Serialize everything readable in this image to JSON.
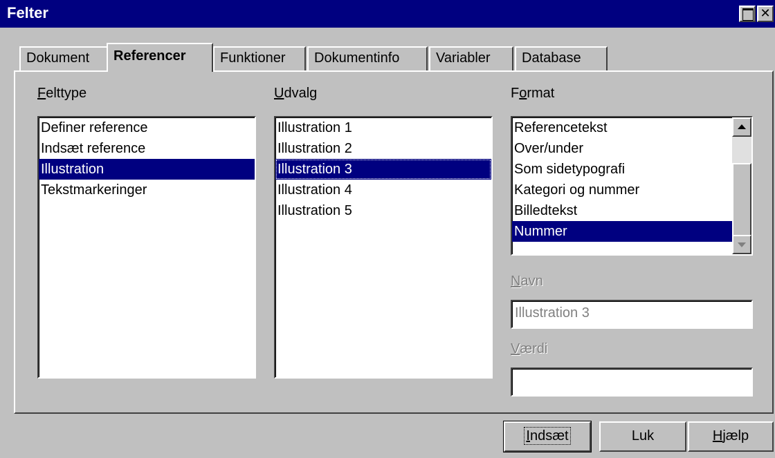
{
  "window": {
    "title": "Felter"
  },
  "tabs": [
    {
      "label": "Dokument",
      "active": false
    },
    {
      "label": "Referencer",
      "active": true
    },
    {
      "label": "Funktioner",
      "active": false
    },
    {
      "label": "Dokumentinfo",
      "active": false
    },
    {
      "label": "Variabler",
      "active": false
    },
    {
      "label": "Database",
      "active": false
    }
  ],
  "felttype": {
    "label_hotkey": "F",
    "label_rest": "elttype",
    "items": [
      "Definer reference",
      "Indsæt reference",
      "Illustration",
      "Tekstmarkeringer"
    ],
    "selected_index": 2
  },
  "udvalg": {
    "label_hotkey": "U",
    "label_rest": "dvalg",
    "items": [
      "Illustration 1",
      "Illustration 2",
      "Illustration 3",
      "Illustration 4",
      "Illustration 5"
    ],
    "selected_index": 2
  },
  "format": {
    "label_pre": "F",
    "label_hotkey": "o",
    "label_rest": "rmat",
    "items": [
      "Referencetekst",
      "Over/under",
      "Som sidetypografi",
      "Kategori og nummer",
      "Billedtekst",
      "Nummer"
    ],
    "selected_index": 5
  },
  "navn": {
    "label_hotkey": "N",
    "label_rest": "avn",
    "value": "Illustration 3"
  },
  "vaerdi": {
    "label_hotkey": "V",
    "label_rest": "ærdi",
    "value": ""
  },
  "buttons": {
    "insert": {
      "hotkey": "I",
      "rest": "ndsæt"
    },
    "close": {
      "label": "Luk"
    },
    "help": {
      "hotkey": "H",
      "rest": "jælp"
    }
  },
  "colors": {
    "titlebar": "#000080",
    "selection": "#000080",
    "face": "#c0c0c0"
  }
}
